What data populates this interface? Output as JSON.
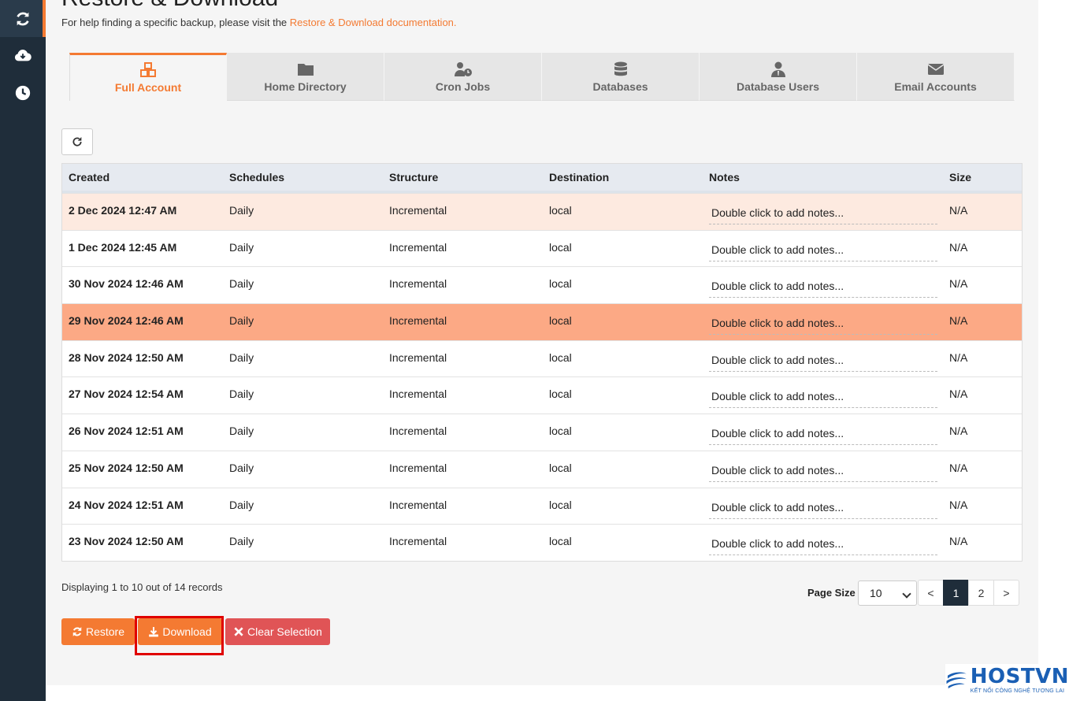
{
  "page": {
    "title": "Restore & Download",
    "help_text": "For help finding a specific backup, please visit the ",
    "help_link": "Restore & Download documentation."
  },
  "sidebar": {
    "items": [
      {
        "name": "backups",
        "icon": "refresh-icon",
        "active": true
      },
      {
        "name": "download",
        "icon": "cloud-download-icon",
        "active": false
      },
      {
        "name": "schedule",
        "icon": "clock-icon",
        "active": false
      }
    ]
  },
  "tabs": [
    {
      "label": "Full Account",
      "icon": "cubes-icon",
      "active": true
    },
    {
      "label": "Home Directory",
      "icon": "folder-icon",
      "active": false
    },
    {
      "label": "Cron Jobs",
      "icon": "user-clock-icon",
      "active": false
    },
    {
      "label": "Databases",
      "icon": "database-icon",
      "active": false
    },
    {
      "label": "Database Users",
      "icon": "user-tie-icon",
      "active": false
    },
    {
      "label": "Email Accounts",
      "icon": "envelope-icon",
      "active": false
    }
  ],
  "table": {
    "headers": [
      "Created",
      "Schedules",
      "Structure",
      "Destination",
      "Notes",
      "Size"
    ],
    "rows": [
      {
        "created": "2 Dec 2024 12:47 AM",
        "schedule": "Daily",
        "structure": "Incremental",
        "destination": "local",
        "notes": "Double click to add notes...",
        "size": "N/A",
        "state": "hover"
      },
      {
        "created": "1 Dec 2024 12:45 AM",
        "schedule": "Daily",
        "structure": "Incremental",
        "destination": "local",
        "notes": "Double click to add notes...",
        "size": "N/A",
        "state": ""
      },
      {
        "created": "30 Nov 2024 12:46 AM",
        "schedule": "Daily",
        "structure": "Incremental",
        "destination": "local",
        "notes": "Double click to add notes...",
        "size": "N/A",
        "state": ""
      },
      {
        "created": "29 Nov 2024 12:46 AM",
        "schedule": "Daily",
        "structure": "Incremental",
        "destination": "local",
        "notes": "Double click to add notes...",
        "size": "N/A",
        "state": "selected"
      },
      {
        "created": "28 Nov 2024 12:50 AM",
        "schedule": "Daily",
        "structure": "Incremental",
        "destination": "local",
        "notes": "Double click to add notes...",
        "size": "N/A",
        "state": ""
      },
      {
        "created": "27 Nov 2024 12:54 AM",
        "schedule": "Daily",
        "structure": "Incremental",
        "destination": "local",
        "notes": "Double click to add notes...",
        "size": "N/A",
        "state": ""
      },
      {
        "created": "26 Nov 2024 12:51 AM",
        "schedule": "Daily",
        "structure": "Incremental",
        "destination": "local",
        "notes": "Double click to add notes...",
        "size": "N/A",
        "state": ""
      },
      {
        "created": "25 Nov 2024 12:50 AM",
        "schedule": "Daily",
        "structure": "Incremental",
        "destination": "local",
        "notes": "Double click to add notes...",
        "size": "N/A",
        "state": ""
      },
      {
        "created": "24 Nov 2024 12:51 AM",
        "schedule": "Daily",
        "structure": "Incremental",
        "destination": "local",
        "notes": "Double click to add notes...",
        "size": "N/A",
        "state": ""
      },
      {
        "created": "23 Nov 2024 12:50 AM",
        "schedule": "Daily",
        "structure": "Incremental",
        "destination": "local",
        "notes": "Double click to add notes...",
        "size": "N/A",
        "state": ""
      }
    ]
  },
  "pagination": {
    "display_info": "Displaying 1 to 10 out of 14 records",
    "page_size_label": "Page Size",
    "page_size_value": "10",
    "prev": "<",
    "pages": [
      "1",
      "2"
    ],
    "current_page": "1",
    "next": ">"
  },
  "actions": {
    "restore_label": "Restore",
    "download_label": "Download",
    "clear_label": "Clear Selection"
  },
  "logo": {
    "name": "HOSTVN",
    "tagline": "KẾT NỐI CÔNG NGHỆ TƯƠNG LAI"
  },
  "colors": {
    "accent": "#f47a32",
    "sidebar": "#1f2d3a",
    "danger": "#e05456",
    "row_selected": "#fca985",
    "row_hover": "#fdeae0"
  }
}
